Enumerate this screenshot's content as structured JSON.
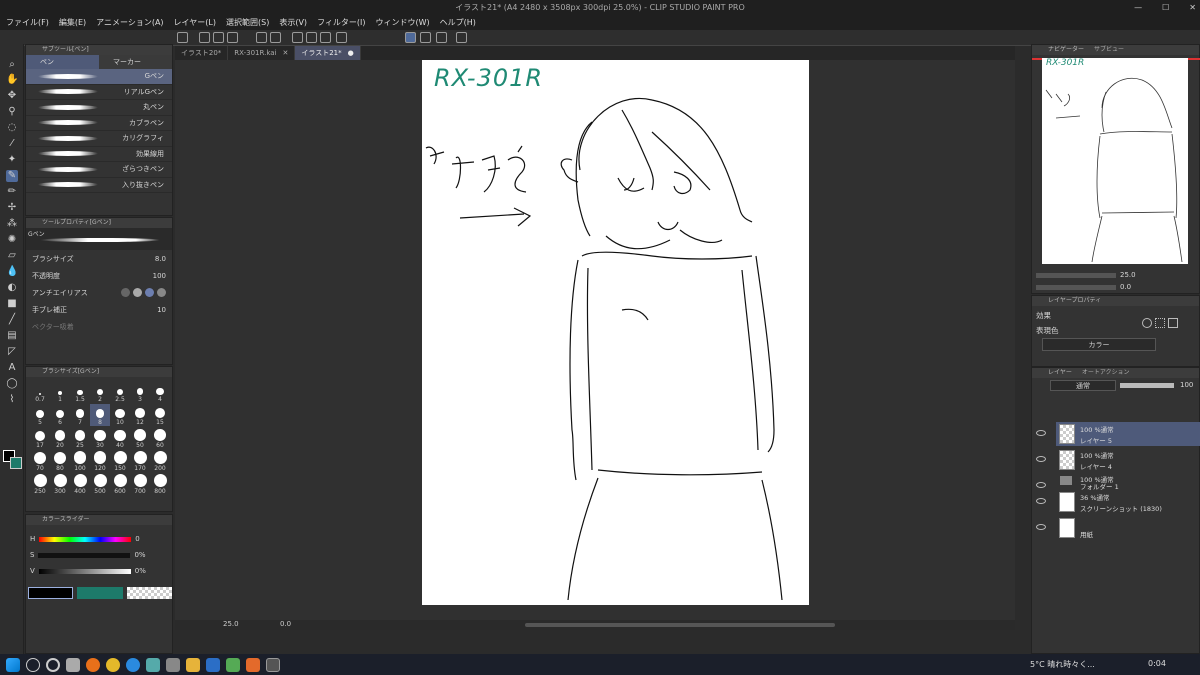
{
  "window": {
    "title": "イラスト21* (A4 2480 x 3508px 300dpi 25.0%) - CLIP STUDIO PAINT PRO"
  },
  "menu": [
    "ファイル(F)",
    "編集(E)",
    "アニメーション(A)",
    "レイヤー(L)",
    "選択範囲(S)",
    "表示(V)",
    "フィルター(I)",
    "ウィンドウ(W)",
    "ヘルプ(H)"
  ],
  "tabs": [
    {
      "label": "イラスト20*",
      "active": false
    },
    {
      "label": "RX-301R.kai",
      "active": false
    },
    {
      "label": "イラスト21*",
      "active": true
    }
  ],
  "subtool": {
    "header": "サブツール[ペン]",
    "tabs": [
      "ペン",
      "マーカー"
    ],
    "brushes": [
      "Gペン",
      "リアルGペン",
      "丸ペン",
      "カブラペン",
      "カリグラフィ",
      "効果線用",
      "ざらつきペン",
      "入り抜きペン"
    ],
    "selected": 0
  },
  "toolprop": {
    "header": "ツールプロパティ[Gペン]",
    "brush_name": "Gペン",
    "brush_size_label": "ブラシサイズ",
    "brush_size_value": "8.0",
    "opacity_label": "不透明度",
    "opacity_value": "100",
    "antialias_label": "アンチエイリアス",
    "stabilizer_label": "手ブレ補正",
    "stabilizer_value": "10",
    "vector_label": "ベクター吸着"
  },
  "brushsize": {
    "header": "ブラシサイズ[Gペン]",
    "sizes": [
      "0.7",
      "1",
      "1.5",
      "2",
      "2.5",
      "3",
      "4",
      "5",
      "6",
      "7",
      "8",
      "10",
      "12",
      "15",
      "17",
      "20",
      "25",
      "30",
      "40",
      "50",
      "60",
      "70",
      "80",
      "100",
      "120",
      "150",
      "170",
      "200",
      "250",
      "300",
      "400",
      "500",
      "600",
      "700",
      "800"
    ],
    "selected": "8"
  },
  "colorslider": {
    "header": "カラースライダー",
    "h_label": "H",
    "h_value": "0",
    "s_label": "S",
    "s_value": "0%",
    "v_label": "V",
    "v_value": "0%",
    "main_color": "#000000",
    "sub_color": "#1d7a6a"
  },
  "canvas": {
    "note_text": "RX-301R",
    "note_color": "#1f8a74"
  },
  "statusbar": {
    "zoom": "25.0",
    "angle": "0.0"
  },
  "navigator": {
    "tabs": [
      "ナビゲーター",
      "サブビュー"
    ],
    "zoom": "25.0",
    "angle": "0.0"
  },
  "layerprop": {
    "tabs": [
      "レイヤープロパティ",
      ""
    ],
    "effect_label": "効果",
    "color_label": "表現色",
    "color_value": "カラー"
  },
  "layers": {
    "tabs": [
      "レイヤー",
      "オートアクション"
    ],
    "blend_mode": "通常",
    "opacity": "100",
    "items": [
      {
        "info": "100 %通常",
        "name": "レイヤー 5",
        "selected": true,
        "type": "raster"
      },
      {
        "info": "100 %通常",
        "name": "レイヤー 4",
        "selected": false,
        "type": "raster"
      },
      {
        "info": "100 %通常",
        "name": "フォルダー 1",
        "selected": false,
        "type": "folder"
      },
      {
        "info": "36 %通常",
        "name": "スクリーンショット (1830)",
        "selected": false,
        "type": "image"
      },
      {
        "info": "",
        "name": "用紙",
        "selected": false,
        "type": "paper"
      }
    ]
  },
  "taskbar": {
    "weather": "5°C 晴れ時々く...",
    "time": "0:04"
  }
}
